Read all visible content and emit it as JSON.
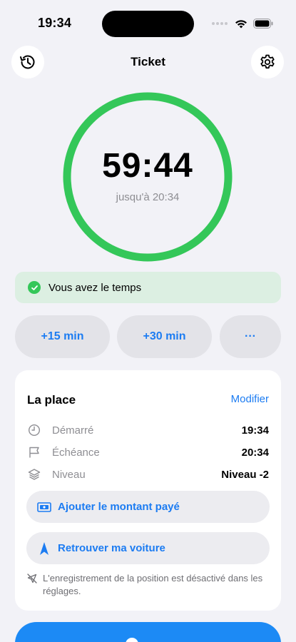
{
  "status_bar": {
    "time": "19:34"
  },
  "header": {
    "title": "Ticket",
    "history_icon": "history-icon",
    "settings_icon": "gear-icon"
  },
  "timer": {
    "remaining": "59:44",
    "until": "jusqu'à 20:34",
    "progress": 1.0,
    "ring_color": "#34c759"
  },
  "status_banner": {
    "text": "Vous avez le temps",
    "color": "#dcefe2"
  },
  "quick_actions": {
    "add15": "+15 min",
    "add30": "+30 min",
    "more": "···"
  },
  "place_card": {
    "title": "La place",
    "edit_label": "Modifier",
    "rows": [
      {
        "label": "Démarré",
        "value": "19:34",
        "icon": "clock-icon"
      },
      {
        "label": "Échéance",
        "value": "20:34",
        "icon": "flag-icon"
      },
      {
        "label": "Niveau",
        "value": "Niveau -2",
        "icon": "layers-icon"
      }
    ],
    "add_amount_label": "Ajouter le montant payé",
    "find_car_label": "Retrouver ma voiture",
    "location_note": "L'enregistrement de la position est désactivé dans les réglages."
  },
  "accent_color": "#1c7cf2"
}
